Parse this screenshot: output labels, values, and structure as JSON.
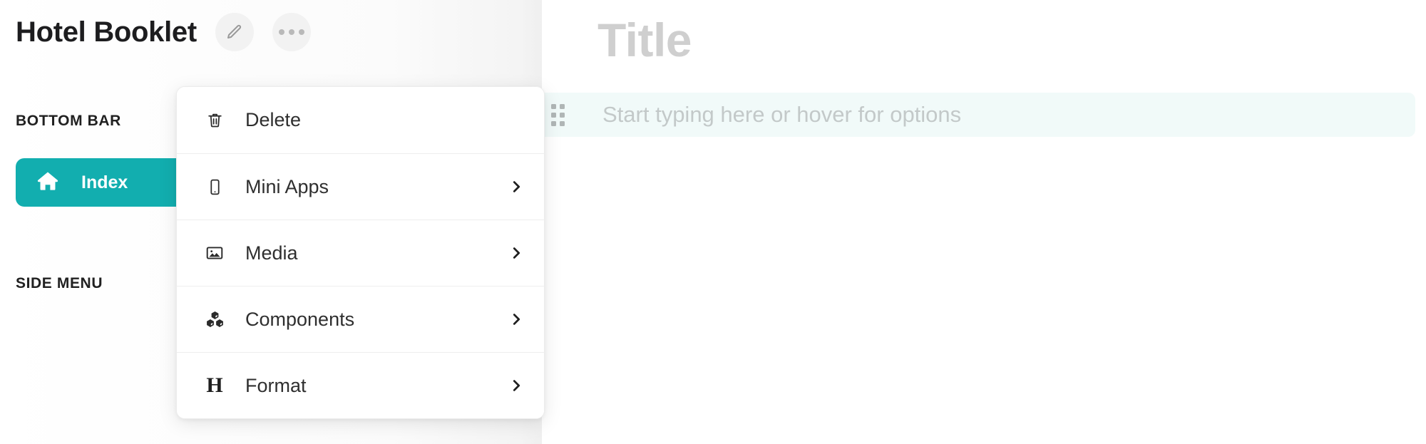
{
  "header": {
    "doc_title": "Hotel Booklet",
    "edit_button_icon": "pencil-icon",
    "more_button_icon": "ellipsis-icon"
  },
  "sidebar": {
    "sections": [
      {
        "label": "BOTTOM BAR"
      },
      {
        "label": "SIDE MENU"
      }
    ],
    "nav_items": [
      {
        "label": "Index",
        "icon": "home-icon",
        "active": true,
        "accent": "#12AEAF"
      }
    ]
  },
  "context_menu": {
    "items": [
      {
        "label": "Delete",
        "icon": "trash-icon",
        "has_submenu": false
      },
      {
        "label": "Mini Apps",
        "icon": "mobile-icon",
        "has_submenu": true
      },
      {
        "label": "Media",
        "icon": "image-icon",
        "has_submenu": true
      },
      {
        "label": "Components",
        "icon": "cubes-icon",
        "has_submenu": true
      },
      {
        "label": "Format",
        "icon": "heading-h-icon",
        "has_submenu": true
      }
    ],
    "chevron_icon": "chevron-right-icon"
  },
  "editor": {
    "title_placeholder": "Title",
    "block_placeholder": "Start typing here or hover for options",
    "drag_handle_icon": "drag-handle-icon",
    "block_highlight_color": "#F1FAF9"
  }
}
